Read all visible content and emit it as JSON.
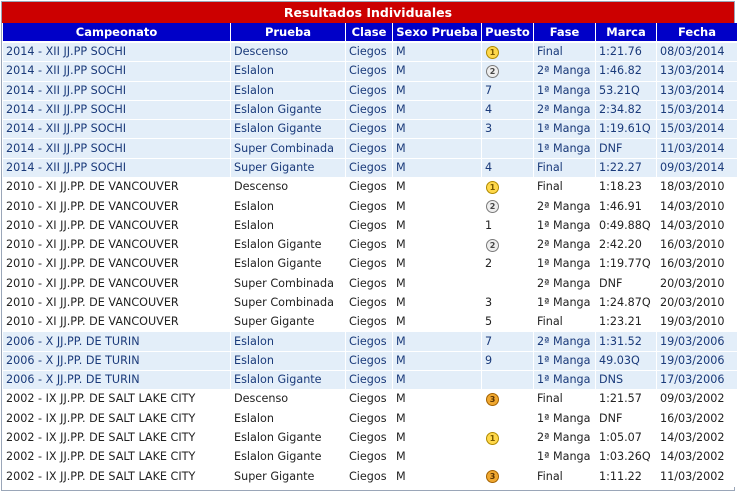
{
  "title": "Resultados Individuales",
  "colors": {
    "title_bg": "#cc0000",
    "header_bg": "#0000c8",
    "row_highlight": "#e3eef9"
  },
  "columns": [
    "Campeonato",
    "Prueba",
    "Clase",
    "Sexo Prueba",
    "Puesto",
    "Fase",
    "Marca",
    "Fecha"
  ],
  "rows": [
    {
      "hl": true,
      "campeonato": "2014 - XII JJ.PP SOCHI",
      "prueba": "Descenso",
      "clase": "Ciegos",
      "sexo": "M",
      "puesto": "",
      "medal": "gold",
      "fase": "Final",
      "marca": "1:21.76",
      "fecha": "08/03/2014"
    },
    {
      "hl": true,
      "campeonato": "2014 - XII JJ.PP SOCHI",
      "prueba": "Eslalon",
      "clase": "Ciegos",
      "sexo": "M",
      "puesto": "",
      "medal": "silver",
      "fase": "2ª Manga",
      "marca": "1:46.82",
      "fecha": "13/03/2014"
    },
    {
      "hl": true,
      "campeonato": "2014 - XII JJ.PP SOCHI",
      "prueba": "Eslalon",
      "clase": "Ciegos",
      "sexo": "M",
      "puesto": "7",
      "medal": "",
      "fase": "1ª Manga",
      "marca": "53.21Q",
      "fecha": "13/03/2014"
    },
    {
      "hl": true,
      "campeonato": "2014 - XII JJ.PP SOCHI",
      "prueba": "Eslalon Gigante",
      "clase": "Ciegos",
      "sexo": "M",
      "puesto": "4",
      "medal": "",
      "fase": "2ª Manga",
      "marca": "2:34.82",
      "fecha": "15/03/2014"
    },
    {
      "hl": true,
      "campeonato": "2014 - XII JJ.PP SOCHI",
      "prueba": "Eslalon Gigante",
      "clase": "Ciegos",
      "sexo": "M",
      "puesto": "3",
      "medal": "",
      "fase": "1ª Manga",
      "marca": "1:19.61Q",
      "fecha": "15/03/2014"
    },
    {
      "hl": true,
      "campeonato": "2014 - XII JJ.PP SOCHI",
      "prueba": "Super Combinada",
      "clase": "Ciegos",
      "sexo": "M",
      "puesto": "",
      "medal": "",
      "fase": "1ª Manga",
      "marca": "DNF",
      "fecha": "11/03/2014"
    },
    {
      "hl": true,
      "campeonato": "2014 - XII JJ.PP SOCHI",
      "prueba": "Super Gigante",
      "clase": "Ciegos",
      "sexo": "M",
      "puesto": "4",
      "medal": "",
      "fase": "Final",
      "marca": "1:22.27",
      "fecha": "09/03/2014"
    },
    {
      "hl": false,
      "campeonato": "2010 - XI JJ.PP. DE VANCOUVER",
      "prueba": "Descenso",
      "clase": "Ciegos",
      "sexo": "M",
      "puesto": "",
      "medal": "gold",
      "fase": "Final",
      "marca": "1:18.23",
      "fecha": "18/03/2010"
    },
    {
      "hl": false,
      "campeonato": "2010 - XI JJ.PP. DE VANCOUVER",
      "prueba": "Eslalon",
      "clase": "Ciegos",
      "sexo": "M",
      "puesto": "",
      "medal": "silver",
      "fase": "2ª Manga",
      "marca": "1:46.91",
      "fecha": "14/03/2010"
    },
    {
      "hl": false,
      "campeonato": "2010 - XI JJ.PP. DE VANCOUVER",
      "prueba": "Eslalon",
      "clase": "Ciegos",
      "sexo": "M",
      "puesto": "1",
      "medal": "",
      "fase": "1ª Manga",
      "marca": "0:49.88Q",
      "fecha": "14/03/2010"
    },
    {
      "hl": false,
      "campeonato": "2010 - XI JJ.PP. DE VANCOUVER",
      "prueba": "Eslalon Gigante",
      "clase": "Ciegos",
      "sexo": "M",
      "puesto": "",
      "medal": "silver",
      "fase": "2ª Manga",
      "marca": "2:42.20",
      "fecha": "16/03/2010"
    },
    {
      "hl": false,
      "campeonato": "2010 - XI JJ.PP. DE VANCOUVER",
      "prueba": "Eslalon Gigante",
      "clase": "Ciegos",
      "sexo": "M",
      "puesto": "2",
      "medal": "",
      "fase": "1ª Manga",
      "marca": "1:19.77Q",
      "fecha": "16/03/2010"
    },
    {
      "hl": false,
      "campeonato": "2010 - XI JJ.PP. DE VANCOUVER",
      "prueba": "Super Combinada",
      "clase": "Ciegos",
      "sexo": "M",
      "puesto": "",
      "medal": "",
      "fase": "2ª Manga",
      "marca": "DNF",
      "fecha": "20/03/2010"
    },
    {
      "hl": false,
      "campeonato": "2010 - XI JJ.PP. DE VANCOUVER",
      "prueba": "Super Combinada",
      "clase": "Ciegos",
      "sexo": "M",
      "puesto": "3",
      "medal": "",
      "fase": "1ª Manga",
      "marca": "1:24.87Q",
      "fecha": "20/03/2010"
    },
    {
      "hl": false,
      "campeonato": "2010 - XI JJ.PP. DE VANCOUVER",
      "prueba": "Super Gigante",
      "clase": "Ciegos",
      "sexo": "M",
      "puesto": "5",
      "medal": "",
      "fase": "Final",
      "marca": "1:23.21",
      "fecha": "19/03/2010"
    },
    {
      "hl": true,
      "campeonato": "2006 - X JJ.PP. DE TURIN",
      "prueba": "Eslalon",
      "clase": "Ciegos",
      "sexo": "M",
      "puesto": "7",
      "medal": "",
      "fase": "2ª Manga",
      "marca": "1:31.52",
      "fecha": "19/03/2006"
    },
    {
      "hl": true,
      "campeonato": "2006 - X JJ.PP. DE TURIN",
      "prueba": "Eslalon",
      "clase": "Ciegos",
      "sexo": "M",
      "puesto": "9",
      "medal": "",
      "fase": "1ª Manga",
      "marca": "49.03Q",
      "fecha": "19/03/2006"
    },
    {
      "hl": true,
      "campeonato": "2006 - X JJ.PP. DE TURIN",
      "prueba": "Eslalon Gigante",
      "clase": "Ciegos",
      "sexo": "M",
      "puesto": "",
      "medal": "",
      "fase": "1ª Manga",
      "marca": "DNS",
      "fecha": "17/03/2006"
    },
    {
      "hl": false,
      "campeonato": "2002 - IX JJ.PP. DE SALT LAKE CITY",
      "prueba": "Descenso",
      "clase": "Ciegos",
      "sexo": "M",
      "puesto": "",
      "medal": "bronze",
      "fase": "Final",
      "marca": "1:21.57",
      "fecha": "09/03/2002"
    },
    {
      "hl": false,
      "campeonato": "2002 - IX JJ.PP. DE SALT LAKE CITY",
      "prueba": "Eslalon",
      "clase": "Ciegos",
      "sexo": "M",
      "puesto": "",
      "medal": "",
      "fase": "1ª Manga",
      "marca": "DNF",
      "fecha": "16/03/2002"
    },
    {
      "hl": false,
      "campeonato": "2002 - IX JJ.PP. DE SALT LAKE CITY",
      "prueba": "Eslalon Gigante",
      "clase": "Ciegos",
      "sexo": "M",
      "puesto": "",
      "medal": "gold",
      "fase": "2ª Manga",
      "marca": "1:05.07",
      "fecha": "14/03/2002"
    },
    {
      "hl": false,
      "campeonato": "2002 - IX JJ.PP. DE SALT LAKE CITY",
      "prueba": "Eslalon Gigante",
      "clase": "Ciegos",
      "sexo": "M",
      "puesto": "",
      "medal": "",
      "fase": "1ª Manga",
      "marca": "1:03.26Q",
      "fecha": "14/03/2002"
    },
    {
      "hl": false,
      "campeonato": "2002 - IX JJ.PP. DE SALT LAKE CITY",
      "prueba": "Super Gigante",
      "clase": "Ciegos",
      "sexo": "M",
      "puesto": "",
      "medal": "bronze",
      "fase": "Final",
      "marca": "1:11.22",
      "fecha": "11/03/2002"
    }
  ]
}
